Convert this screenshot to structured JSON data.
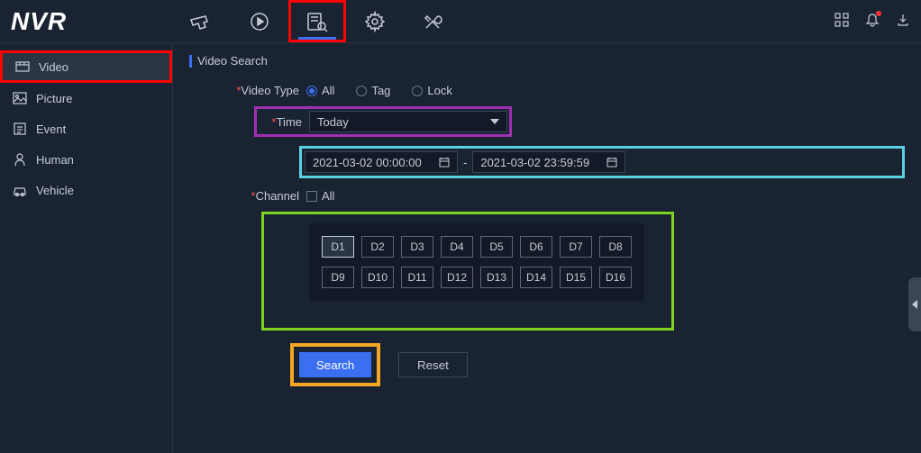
{
  "logo": "NVR",
  "nav": {
    "items": [
      "camera-icon",
      "playback-icon",
      "search-icon",
      "settings-icon",
      "tools-icon"
    ],
    "active_index": 2
  },
  "header_right": [
    "qr-icon",
    "bell-icon",
    "download-icon"
  ],
  "sidebar": {
    "items": [
      {
        "label": "Video",
        "icon": "video"
      },
      {
        "label": "Picture",
        "icon": "picture"
      },
      {
        "label": "Event",
        "icon": "event"
      },
      {
        "label": "Human",
        "icon": "human"
      },
      {
        "label": "Vehicle",
        "icon": "vehicle"
      }
    ],
    "active_index": 0
  },
  "section_title": "Video Search",
  "form": {
    "video_type": {
      "label": "Video Type",
      "options": [
        "All",
        "Tag",
        "Lock"
      ],
      "selected": "All"
    },
    "time": {
      "label": "Time",
      "value": "Today",
      "start": "2021-03-02 00:00:00",
      "end": "2021-03-02 23:59:59",
      "separator": "-"
    },
    "channel": {
      "label": "Channel",
      "all_label": "All",
      "items": [
        "D1",
        "D2",
        "D3",
        "D4",
        "D5",
        "D6",
        "D7",
        "D8",
        "D9",
        "D10",
        "D11",
        "D12",
        "D13",
        "D14",
        "D15",
        "D16"
      ],
      "active": "D1"
    },
    "buttons": {
      "search": "Search",
      "reset": "Reset"
    }
  }
}
